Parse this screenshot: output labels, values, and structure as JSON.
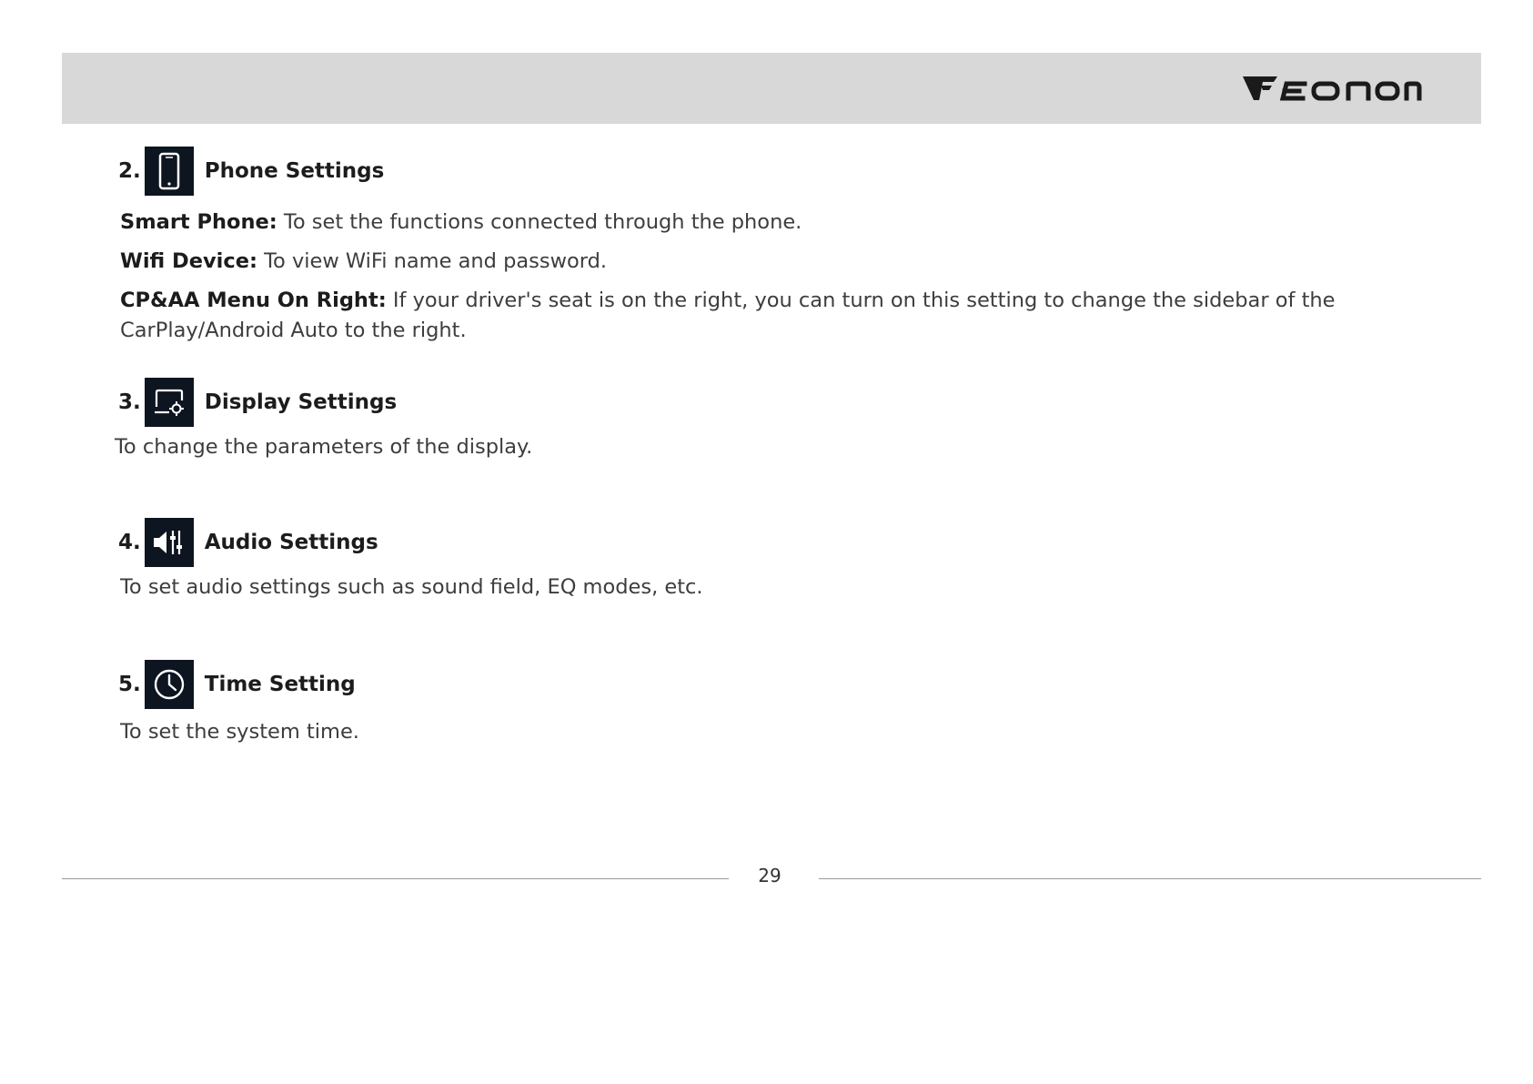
{
  "header": {
    "logo_text": "EONON",
    "logo_icon": "eonon-logo-icon"
  },
  "sections": [
    {
      "number": "2.",
      "icon": "smartphone-icon",
      "title": "Phone Settings",
      "items": [
        {
          "label": "Smart Phone:",
          "text": "To set the functions connected through the phone."
        },
        {
          "label": "Wifi Device:",
          "text": "To view WiFi name and password."
        },
        {
          "label": "CP&AA Menu On Right:",
          "text": "If your driver's seat is on the right, you can turn on this setting to change the sidebar of the",
          "continuation": "CarPlay/Android Auto to the right."
        }
      ]
    },
    {
      "number": "3.",
      "icon": "display-settings-icon",
      "title": "Display Settings",
      "description": "To change the parameters of the display."
    },
    {
      "number": "4.",
      "icon": "audio-settings-icon",
      "title": "Audio Settings",
      "description": "To set audio settings such as sound field, EQ modes, etc."
    },
    {
      "number": "5.",
      "icon": "clock-icon",
      "title": "Time Setting",
      "description": "To set the system time."
    }
  ],
  "footer": {
    "page_number": "29"
  },
  "colors": {
    "header_band": "#d8d8d8",
    "icon_background": "#0d1520",
    "body_text": "#3d3d3d",
    "heading_text": "#1c1c1c"
  }
}
